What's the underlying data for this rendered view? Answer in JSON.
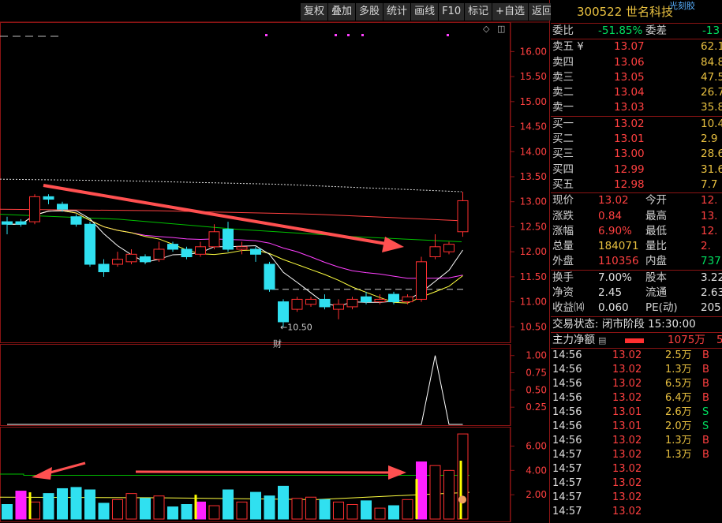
{
  "toolbar": {
    "buttons": [
      "复权",
      "叠加",
      "多股",
      "统计",
      "画线",
      "F10",
      "标记",
      "+自选",
      "返回"
    ]
  },
  "stock": {
    "title": "300522 世名科技",
    "tag": "光刻胶"
  },
  "order_book": {
    "weibi_label": "委比",
    "weibi_value": "-51.85%",
    "weicha_label": "委差",
    "weicha_value": "-13",
    "asks": [
      {
        "label": "卖五 ¥",
        "price": "13.07",
        "vol": "62.1"
      },
      {
        "label": "卖四",
        "price": "13.06",
        "vol": "84.8"
      },
      {
        "label": "卖三",
        "price": "13.05",
        "vol": "47.5"
      },
      {
        "label": "卖二",
        "price": "13.04",
        "vol": "26.7"
      },
      {
        "label": "卖一",
        "price": "13.03",
        "vol": "35.8"
      }
    ],
    "bids": [
      {
        "label": "买一",
        "price": "13.02",
        "vol": "10.4"
      },
      {
        "label": "买二",
        "price": "13.01",
        "vol": "2.9"
      },
      {
        "label": "买三",
        "price": "13.00",
        "vol": "28.6"
      },
      {
        "label": "买四",
        "price": "12.99",
        "vol": "31.6"
      },
      {
        "label": "买五",
        "price": "12.98",
        "vol": "7.7"
      }
    ]
  },
  "quote": {
    "rows": [
      {
        "l1": "现价",
        "v1": "13.02",
        "l2": "今开",
        "v2": "12."
      },
      {
        "l1": "涨跌",
        "v1": "0.84",
        "l2": "最高",
        "v2": "13."
      },
      {
        "l1": "涨幅",
        "v1": "6.90%",
        "l2": "最低",
        "v2": "12."
      },
      {
        "l1": "总量",
        "v1": "184071",
        "l2": "量比",
        "v2": "2."
      },
      {
        "l1": "外盘",
        "v1": "110356",
        "l2": "内盘",
        "v2": "737"
      }
    ]
  },
  "stats": {
    "rows": [
      {
        "l1": "换手",
        "v1": "7.00%",
        "l2": "股本",
        "v2": "3.22"
      },
      {
        "l1": "净资",
        "v1": "2.45",
        "l2": "流通",
        "v2": "2.63"
      },
      {
        "l1": "收益⒁",
        "v1": "0.060",
        "l2": "PE(动)",
        "v2": "205"
      }
    ]
  },
  "status": {
    "label": "交易状态: 闭市阶段 15:30:00"
  },
  "net_flow": {
    "label": "主力净额",
    "value": "1075万",
    "extra": "5"
  },
  "ticks": [
    {
      "time": "14:56",
      "price": "13.02",
      "vol": "2.5万",
      "side": "B"
    },
    {
      "time": "14:56",
      "price": "13.02",
      "vol": "1.3万",
      "side": "B"
    },
    {
      "time": "14:56",
      "price": "13.02",
      "vol": "6.5万",
      "side": "B"
    },
    {
      "time": "14:56",
      "price": "13.02",
      "vol": "6.4万",
      "side": "B"
    },
    {
      "time": "14:56",
      "price": "13.01",
      "vol": "2.6万",
      "side": "S"
    },
    {
      "time": "14:56",
      "price": "13.01",
      "vol": "2.0万",
      "side": "S"
    },
    {
      "time": "14:56",
      "price": "13.02",
      "vol": "1.3万",
      "side": "B"
    },
    {
      "time": "14:57",
      "price": "13.02",
      "vol": "1.3万",
      "side": "B"
    },
    {
      "time": "14:57",
      "price": "13.02",
      "vol": "",
      "side": ""
    },
    {
      "time": "14:57",
      "price": "13.02",
      "vol": "",
      "side": ""
    },
    {
      "time": "14:57",
      "price": "13.02",
      "vol": "",
      "side": ""
    },
    {
      "time": "14:57",
      "price": "13.02",
      "vol": "",
      "side": ""
    }
  ],
  "chart_data": [
    {
      "type": "candlestick",
      "y_ticks": [
        "16.00",
        "15.50",
        "15.00",
        "14.50",
        "14.00",
        "13.50",
        "13.00",
        "12.50",
        "12.00",
        "11.50",
        "11.00",
        "10.50"
      ],
      "ylim": [
        10.3,
        16.4
      ],
      "low_annotation": "10.50",
      "event_marker": "财",
      "colors": {
        "up": "#ff3030",
        "down": "#30e0f0",
        "ma5": "#ffffff",
        "ma10": "#ffff40",
        "ma20": "#ff40ff",
        "ma60": "#00c000",
        "ma120": "#ff4040",
        "arrow": "#ff5050"
      },
      "candles": [
        {
          "o": 12.6,
          "c": 12.55,
          "h": 12.7,
          "l": 12.35
        },
        {
          "o": 12.6,
          "c": 12.55,
          "h": 12.65,
          "l": 12.5
        },
        {
          "o": 12.6,
          "c": 13.1,
          "h": 13.15,
          "l": 12.55
        },
        {
          "o": 13.1,
          "c": 13.05,
          "h": 13.15,
          "l": 12.95
        },
        {
          "o": 12.95,
          "c": 12.85,
          "h": 13.0,
          "l": 12.8
        },
        {
          "o": 12.7,
          "c": 12.55,
          "h": 12.75,
          "l": 12.5
        },
        {
          "o": 12.55,
          "c": 11.75,
          "h": 12.6,
          "l": 11.7
        },
        {
          "o": 11.75,
          "c": 11.6,
          "h": 11.85,
          "l": 11.5
        },
        {
          "o": 11.75,
          "c": 11.85,
          "h": 12.0,
          "l": 11.7
        },
        {
          "o": 11.8,
          "c": 11.95,
          "h": 12.05,
          "l": 11.75
        },
        {
          "o": 11.9,
          "c": 11.8,
          "h": 11.95,
          "l": 11.75
        },
        {
          "o": 11.85,
          "c": 12.05,
          "h": 12.2,
          "l": 11.8
        },
        {
          "o": 12.15,
          "c": 12.05,
          "h": 12.2,
          "l": 12.0
        },
        {
          "o": 12.05,
          "c": 11.9,
          "h": 12.1,
          "l": 11.85
        },
        {
          "o": 11.95,
          "c": 12.1,
          "h": 12.2,
          "l": 11.9
        },
        {
          "o": 12.1,
          "c": 12.4,
          "h": 12.55,
          "l": 12.05
        },
        {
          "o": 12.45,
          "c": 12.05,
          "h": 12.6,
          "l": 12.0
        },
        {
          "o": 12.05,
          "c": 12.1,
          "h": 12.2,
          "l": 11.95
        },
        {
          "o": 12.05,
          "c": 11.95,
          "h": 12.1,
          "l": 11.8
        },
        {
          "o": 11.75,
          "c": 11.25,
          "h": 11.8,
          "l": 11.2
        },
        {
          "o": 11.0,
          "c": 10.6,
          "h": 11.05,
          "l": 10.5
        },
        {
          "o": 10.85,
          "c": 11.05,
          "h": 11.1,
          "l": 10.8
        },
        {
          "o": 10.95,
          "c": 11.05,
          "h": 11.1,
          "l": 10.9
        },
        {
          "o": 11.05,
          "c": 10.9,
          "h": 11.15,
          "l": 10.85
        },
        {
          "o": 10.85,
          "c": 10.95,
          "h": 11.05,
          "l": 10.65
        },
        {
          "o": 10.9,
          "c": 11.05,
          "h": 11.1,
          "l": 10.85
        },
        {
          "o": 11.1,
          "c": 11.0,
          "h": 11.2,
          "l": 10.95
        },
        {
          "o": 11.0,
          "c": 11.05,
          "h": 11.15,
          "l": 10.95
        },
        {
          "o": 11.15,
          "c": 11.0,
          "h": 11.2,
          "l": 10.95
        },
        {
          "o": 11.0,
          "c": 11.1,
          "h": 11.15,
          "l": 10.95
        },
        {
          "o": 11.05,
          "c": 11.8,
          "h": 11.9,
          "l": 11.0
        },
        {
          "o": 11.9,
          "c": 12.1,
          "h": 12.35,
          "l": 11.85
        },
        {
          "o": 12.0,
          "c": 12.15,
          "h": 12.2,
          "l": 11.95
        },
        {
          "o": 12.4,
          "c": 13.02,
          "h": 13.2,
          "l": 12.3
        }
      ]
    },
    {
      "type": "line",
      "y_ticks": [
        "1.00",
        "0.75",
        "0.50",
        "0.25"
      ],
      "ylim": [
        0,
        1.1
      ],
      "values": [
        0,
        0,
        0,
        0,
        0,
        0,
        0,
        0,
        0,
        0,
        0,
        0,
        0,
        0,
        0,
        0,
        0,
        0,
        0,
        0,
        0,
        0,
        0,
        0,
        0,
        0,
        0,
        0,
        0,
        0,
        0,
        1.0,
        0,
        0
      ]
    },
    {
      "type": "bar",
      "y_ticks": [
        "6.00",
        "4.00",
        "2.00"
      ],
      "ylim": [
        0,
        7.2
      ],
      "values": [
        1.2,
        2.3,
        1.4,
        2.1,
        2.5,
        2.6,
        2.4,
        1.3,
        1.6,
        2.1,
        1.7,
        1.9,
        1.0,
        1.2,
        1.4,
        1.1,
        2.4,
        1.4,
        2.2,
        1.9,
        2.7,
        1.7,
        1.8,
        1.6,
        1.4,
        1.2,
        1.5,
        0.9,
        1.1,
        1.6,
        4.7,
        4.4,
        4.0,
        7.0
      ]
    }
  ]
}
